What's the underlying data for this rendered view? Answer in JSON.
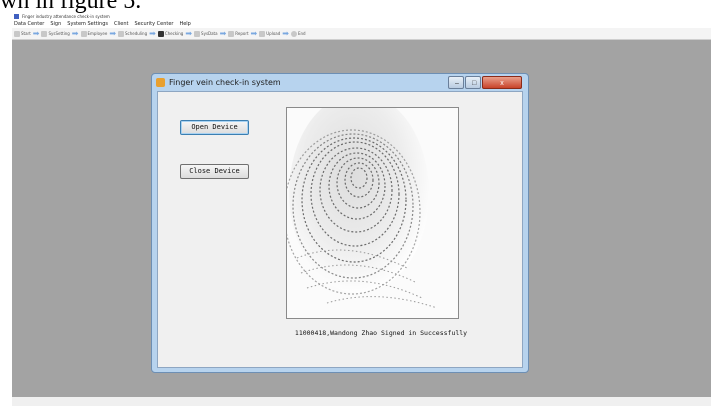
{
  "caption": "wn in figure 5.",
  "app": {
    "title": "Finger industry attendance check-in system",
    "menu": [
      "Data Center",
      "Sign",
      "System Settings",
      "Client",
      "Security Center",
      "Help"
    ],
    "toolbar": [
      "Start",
      "SysSetting",
      "Employee",
      "Scheduling",
      "Checking",
      "SysData",
      "Report",
      "Upload",
      "End"
    ]
  },
  "dialog": {
    "title": "Finger vein check-in system",
    "window_buttons": {
      "minimize": "–",
      "maximize": "□",
      "close": "x"
    },
    "open_device_label": "Open Device",
    "close_device_label": "Close Device",
    "status_message": "11000418,Wandong Zhao Signed in Successfully"
  },
  "colors": {
    "desktop": "#a3a3a3",
    "dialog_frame": "#b7d3ee",
    "dialog_client": "#f0f0f0",
    "close_button": "#c8432a"
  }
}
